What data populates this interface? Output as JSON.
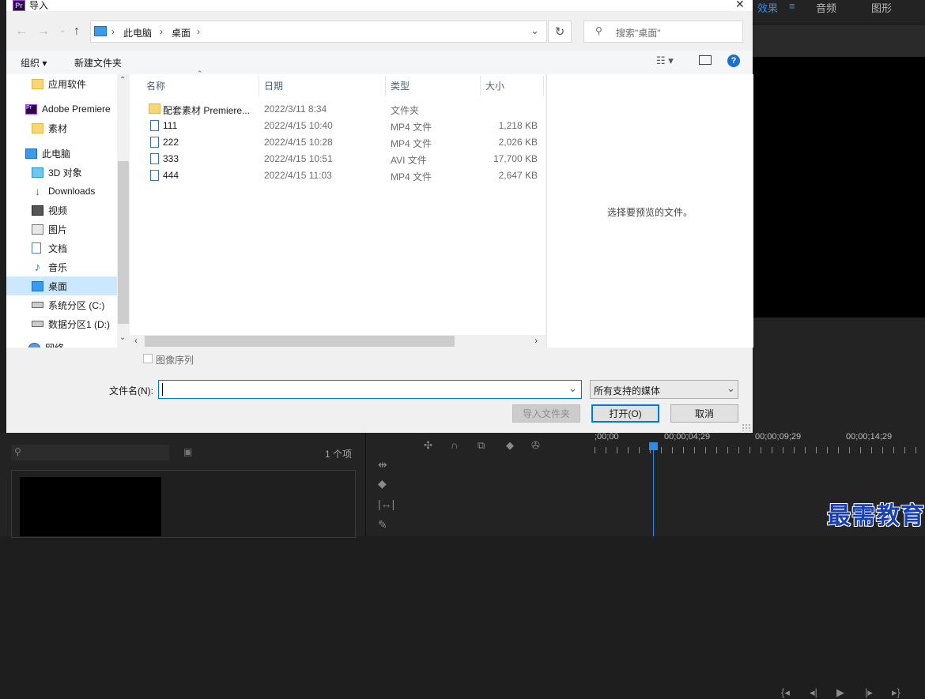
{
  "dialog": {
    "title": "导入",
    "app_icon": "Pr",
    "close_glyph": "✕",
    "address": {
      "segments": [
        "此电脑",
        "桌面"
      ]
    },
    "search_placeholder": "搜索\"桌面\"",
    "toolbar": {
      "organize": "组织 ▾",
      "new_folder": "新建文件夹"
    },
    "nav": [
      {
        "label": "应用软件",
        "icon": "folder-icon"
      },
      {
        "label": "Adobe Premiere",
        "icon": "premiere-icon"
      },
      {
        "label": "素材",
        "icon": "folder-icon"
      },
      {
        "label": "此电脑",
        "icon": "pc-icon"
      },
      {
        "label": "3D 对象",
        "icon": "cube-icon"
      },
      {
        "label": "Downloads",
        "icon": "download-icon"
      },
      {
        "label": "视频",
        "icon": "video-icon"
      },
      {
        "label": "图片",
        "icon": "picture-icon"
      },
      {
        "label": "文档",
        "icon": "document-icon"
      },
      {
        "label": "音乐",
        "icon": "music-icon"
      },
      {
        "label": "桌面",
        "icon": "desktop-icon",
        "selected": true
      },
      {
        "label": "系统分区 (C:)",
        "icon": "drive-icon"
      },
      {
        "label": "数据分区1 (D:)",
        "icon": "drive-icon"
      },
      {
        "label": "网络",
        "icon": "network-icon"
      }
    ],
    "columns": {
      "name": "名称",
      "date": "日期",
      "type": "类型",
      "size": "大小"
    },
    "files": [
      {
        "name": "配套素材 Premiere...",
        "date": "2022/3/11 8:34",
        "type": "文件夹",
        "size": "",
        "kind": "folder"
      },
      {
        "name": "111",
        "date": "2022/4/15 10:40",
        "type": "MP4 文件",
        "size": "1,218 KB",
        "kind": "file"
      },
      {
        "name": "222",
        "date": "2022/4/15 10:28",
        "type": "MP4 文件",
        "size": "2,026 KB",
        "kind": "file"
      },
      {
        "name": "333",
        "date": "2022/4/15 10:51",
        "type": "AVI 文件",
        "size": "17,700 KB",
        "kind": "file"
      },
      {
        "name": "444",
        "date": "2022/4/15 11:03",
        "type": "MP4 文件",
        "size": "2,647 KB",
        "kind": "file"
      }
    ],
    "preview_text": "选择要预览的文件。",
    "image_sequence": "图像序列",
    "filename_label": "文件名(N):",
    "filename_value": "",
    "filetype": "所有支持的媒体",
    "buttons": {
      "import_folder": "导入文件夹",
      "open": "打开(O)",
      "cancel": "取消"
    }
  },
  "premiere": {
    "tabs": [
      "效果",
      "音频",
      "图形"
    ],
    "item_count": "1 个项",
    "timecodes": [
      ";00;00",
      "00;00;04;29",
      "00;00;09;29",
      "00;00;14;29"
    ],
    "watermark": "最需教育",
    "accent_color": "#2d8ceb"
  }
}
